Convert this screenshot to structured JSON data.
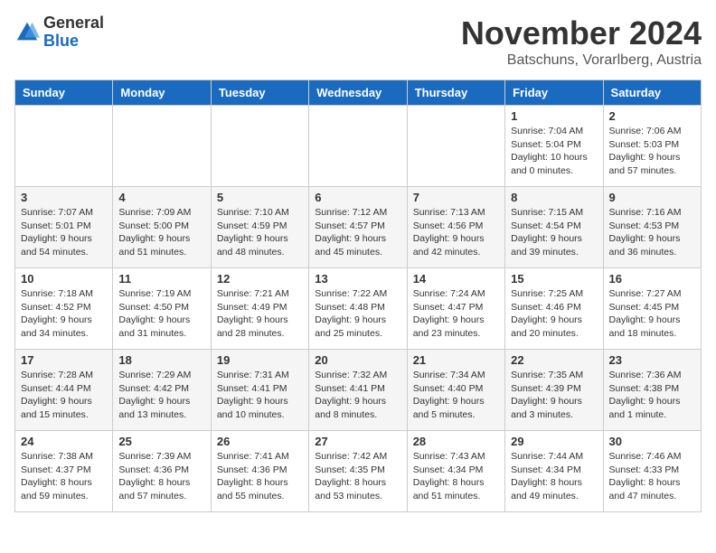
{
  "logo": {
    "general": "General",
    "blue": "Blue"
  },
  "title": "November 2024",
  "subtitle": "Batschuns, Vorarlberg, Austria",
  "weekdays": [
    "Sunday",
    "Monday",
    "Tuesday",
    "Wednesday",
    "Thursday",
    "Friday",
    "Saturday"
  ],
  "weeks": [
    [
      {
        "day": "",
        "info": ""
      },
      {
        "day": "",
        "info": ""
      },
      {
        "day": "",
        "info": ""
      },
      {
        "day": "",
        "info": ""
      },
      {
        "day": "",
        "info": ""
      },
      {
        "day": "1",
        "info": "Sunrise: 7:04 AM\nSunset: 5:04 PM\nDaylight: 10 hours\nand 0 minutes."
      },
      {
        "day": "2",
        "info": "Sunrise: 7:06 AM\nSunset: 5:03 PM\nDaylight: 9 hours\nand 57 minutes."
      }
    ],
    [
      {
        "day": "3",
        "info": "Sunrise: 7:07 AM\nSunset: 5:01 PM\nDaylight: 9 hours\nand 54 minutes."
      },
      {
        "day": "4",
        "info": "Sunrise: 7:09 AM\nSunset: 5:00 PM\nDaylight: 9 hours\nand 51 minutes."
      },
      {
        "day": "5",
        "info": "Sunrise: 7:10 AM\nSunset: 4:59 PM\nDaylight: 9 hours\nand 48 minutes."
      },
      {
        "day": "6",
        "info": "Sunrise: 7:12 AM\nSunset: 4:57 PM\nDaylight: 9 hours\nand 45 minutes."
      },
      {
        "day": "7",
        "info": "Sunrise: 7:13 AM\nSunset: 4:56 PM\nDaylight: 9 hours\nand 42 minutes."
      },
      {
        "day": "8",
        "info": "Sunrise: 7:15 AM\nSunset: 4:54 PM\nDaylight: 9 hours\nand 39 minutes."
      },
      {
        "day": "9",
        "info": "Sunrise: 7:16 AM\nSunset: 4:53 PM\nDaylight: 9 hours\nand 36 minutes."
      }
    ],
    [
      {
        "day": "10",
        "info": "Sunrise: 7:18 AM\nSunset: 4:52 PM\nDaylight: 9 hours\nand 34 minutes."
      },
      {
        "day": "11",
        "info": "Sunrise: 7:19 AM\nSunset: 4:50 PM\nDaylight: 9 hours\nand 31 minutes."
      },
      {
        "day": "12",
        "info": "Sunrise: 7:21 AM\nSunset: 4:49 PM\nDaylight: 9 hours\nand 28 minutes."
      },
      {
        "day": "13",
        "info": "Sunrise: 7:22 AM\nSunset: 4:48 PM\nDaylight: 9 hours\nand 25 minutes."
      },
      {
        "day": "14",
        "info": "Sunrise: 7:24 AM\nSunset: 4:47 PM\nDaylight: 9 hours\nand 23 minutes."
      },
      {
        "day": "15",
        "info": "Sunrise: 7:25 AM\nSunset: 4:46 PM\nDaylight: 9 hours\nand 20 minutes."
      },
      {
        "day": "16",
        "info": "Sunrise: 7:27 AM\nSunset: 4:45 PM\nDaylight: 9 hours\nand 18 minutes."
      }
    ],
    [
      {
        "day": "17",
        "info": "Sunrise: 7:28 AM\nSunset: 4:44 PM\nDaylight: 9 hours\nand 15 minutes."
      },
      {
        "day": "18",
        "info": "Sunrise: 7:29 AM\nSunset: 4:42 PM\nDaylight: 9 hours\nand 13 minutes."
      },
      {
        "day": "19",
        "info": "Sunrise: 7:31 AM\nSunset: 4:41 PM\nDaylight: 9 hours\nand 10 minutes."
      },
      {
        "day": "20",
        "info": "Sunrise: 7:32 AM\nSunset: 4:41 PM\nDaylight: 9 hours\nand 8 minutes."
      },
      {
        "day": "21",
        "info": "Sunrise: 7:34 AM\nSunset: 4:40 PM\nDaylight: 9 hours\nand 5 minutes."
      },
      {
        "day": "22",
        "info": "Sunrise: 7:35 AM\nSunset: 4:39 PM\nDaylight: 9 hours\nand 3 minutes."
      },
      {
        "day": "23",
        "info": "Sunrise: 7:36 AM\nSunset: 4:38 PM\nDaylight: 9 hours\nand 1 minute."
      }
    ],
    [
      {
        "day": "24",
        "info": "Sunrise: 7:38 AM\nSunset: 4:37 PM\nDaylight: 8 hours\nand 59 minutes."
      },
      {
        "day": "25",
        "info": "Sunrise: 7:39 AM\nSunset: 4:36 PM\nDaylight: 8 hours\nand 57 minutes."
      },
      {
        "day": "26",
        "info": "Sunrise: 7:41 AM\nSunset: 4:36 PM\nDaylight: 8 hours\nand 55 minutes."
      },
      {
        "day": "27",
        "info": "Sunrise: 7:42 AM\nSunset: 4:35 PM\nDaylight: 8 hours\nand 53 minutes."
      },
      {
        "day": "28",
        "info": "Sunrise: 7:43 AM\nSunset: 4:34 PM\nDaylight: 8 hours\nand 51 minutes."
      },
      {
        "day": "29",
        "info": "Sunrise: 7:44 AM\nSunset: 4:34 PM\nDaylight: 8 hours\nand 49 minutes."
      },
      {
        "day": "30",
        "info": "Sunrise: 7:46 AM\nSunset: 4:33 PM\nDaylight: 8 hours\nand 47 minutes."
      }
    ]
  ]
}
